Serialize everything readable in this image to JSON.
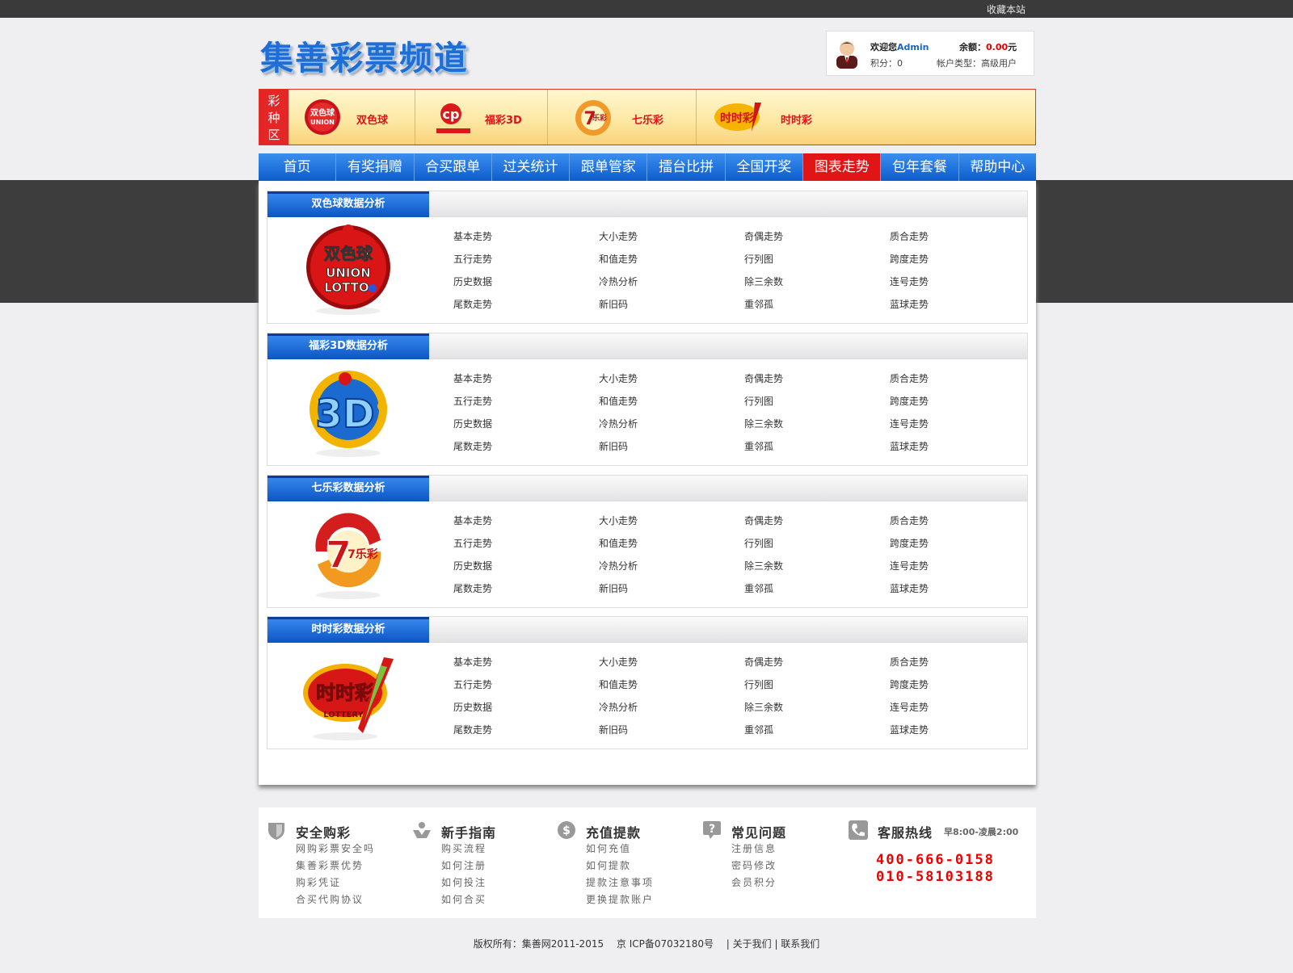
{
  "topbar": {
    "bookmark": "收藏本站"
  },
  "logo": {
    "text": "集善彩票频道"
  },
  "user": {
    "welcome": "欢迎您",
    "name": "Admin",
    "balance_label": "余额：",
    "balance_value": "0.00",
    "balance_unit": "元",
    "points": "积分：0",
    "account_type": "帐户类型：高级用户"
  },
  "lottery_bar": {
    "tag": "彩种区",
    "items": [
      {
        "name": "双色球",
        "icon": "union-lotto-icon"
      },
      {
        "name": "福彩3D",
        "icon": "welfare-lottery-icon"
      },
      {
        "name": "七乐彩",
        "icon": "7le-icon"
      },
      {
        "name": "时时彩",
        "icon": "shishicai-icon"
      }
    ]
  },
  "nav": [
    "首页",
    "有奖捐赠",
    "合买跟单",
    "过关统计",
    "跟单管家",
    "擂台比拼",
    "全国开奖",
    "图表走势",
    "包年套餐",
    "帮助中心"
  ],
  "nav_active": "图表走势",
  "sections": [
    {
      "title": "双色球数据分析",
      "logo_text": "双色球",
      "logo_sub1": "UNION",
      "logo_sub2": "LOTTO",
      "links": [
        "基本走势",
        "大小走势",
        "奇偶走势",
        "质合走势",
        "五行走势",
        "和值走势",
        "行列图",
        "跨度走势",
        "历史数据",
        "冷热分析",
        "除三余数",
        "连号走势",
        "尾数走势",
        "新旧码",
        "重邻孤",
        "蓝球走势"
      ]
    },
    {
      "title": "福彩3D数据分析",
      "logo_text": "3D",
      "links": [
        "基本走势",
        "大小走势",
        "奇偶走势",
        "质合走势",
        "五行走势",
        "和值走势",
        "行列图",
        "跨度走势",
        "历史数据",
        "冷热分析",
        "除三余数",
        "连号走势",
        "尾数走势",
        "新旧码",
        "重邻孤",
        "蓝球走势"
      ]
    },
    {
      "title": "七乐彩数据分析",
      "logo_text": "7乐彩",
      "links": [
        "基本走势",
        "大小走势",
        "奇偶走势",
        "质合走势",
        "五行走势",
        "和值走势",
        "行列图",
        "跨度走势",
        "历史数据",
        "冷热分析",
        "除三余数",
        "连号走势",
        "尾数走势",
        "新旧码",
        "重邻孤",
        "蓝球走势"
      ]
    },
    {
      "title": "时时彩数据分析",
      "logo_text": "时时彩",
      "logo_sub1": "LOTTERY",
      "links": [
        "基本走势",
        "大小走势",
        "奇偶走势",
        "质合走势",
        "五行走势",
        "和值走势",
        "行列图",
        "跨度走势",
        "历史数据",
        "冷热分析",
        "除三余数",
        "连号走势",
        "尾数走势",
        "新旧码",
        "重邻孤",
        "蓝球走势"
      ]
    }
  ],
  "footer": {
    "columns": [
      {
        "title": "安全购彩",
        "icon": "shield-icon",
        "items": [
          "网购彩票安全吗",
          "集善彩票优势",
          "购彩凭证",
          "合买代购协议"
        ]
      },
      {
        "title": "新手指南",
        "icon": "hand-icon",
        "items": [
          "购买流程",
          "如何注册",
          "如何投注",
          "如何合买"
        ]
      },
      {
        "title": "充值提款",
        "icon": "dollar-icon",
        "items": [
          "如何充值",
          "如何提款",
          "提款注意事项",
          "更换提款账户"
        ]
      },
      {
        "title": "常见问题",
        "icon": "question-icon",
        "items": [
          "注册信息",
          "密码修改",
          "会员积分"
        ]
      }
    ],
    "hotline_title": "客服热线",
    "hotline_hours": "早8:00-凌晨2:00",
    "phones": [
      "400-666-0158",
      "010-58103188"
    ]
  },
  "copyright": "版权所有：集善网2011-2015　 京 ICP备07032180号 　| 关于我们 | 联系我们",
  "colors": {
    "nav_blue": "#0d5ccb",
    "active_red": "#e11515",
    "accent_red": "#e00000"
  }
}
